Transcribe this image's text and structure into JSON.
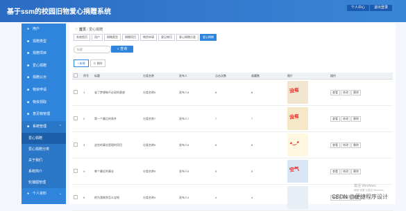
{
  "header": {
    "title": "基于ssm的校园旧物爱心捐赠系统",
    "buttons": [
      "个人中心",
      "退出登录"
    ]
  },
  "sidebar": {
    "items": [
      {
        "icon": "user-icon",
        "label": "用户"
      },
      {
        "icon": "grid-icon",
        "label": "捐赠类型"
      },
      {
        "icon": "grid-icon",
        "label": "捐赠项目"
      },
      {
        "icon": "grid-icon",
        "label": "爱心捐赠"
      },
      {
        "icon": "grid-icon",
        "label": "捐赠公示"
      },
      {
        "icon": "grid-icon",
        "label": "物资申请"
      },
      {
        "icon": "grid-icon",
        "label": "物资领取"
      },
      {
        "icon": "grid-icon",
        "label": "意见物管理"
      },
      {
        "icon": "grid-icon",
        "label": "系统管理"
      }
    ],
    "sub_items": [
      "爱心捐赠",
      "爱心捐赠分类",
      "关于我们",
      "系统简介",
      "轮播图管理"
    ],
    "last_item": {
      "icon": "person-icon",
      "label": "个人资料"
    }
  },
  "breadcrumb": {
    "home": "首页",
    "current": "爱心捐赠"
  },
  "tabs": [
    "系统首页",
    "用户",
    "捐赠类型",
    "捐赠项目",
    "物资申请",
    "意见物归",
    "意心捐赠分类",
    "爱心捐赠"
  ],
  "search": {
    "placeholder": "标题",
    "button_label": "查询"
  },
  "actions": {
    "add_label": "新增",
    "delete_label": "删除"
  },
  "table": {
    "headers": [
      "",
      "序号",
      "标题",
      "分类名称",
      "发布人",
      "点击次数",
      "收藏数",
      "图片",
      "操作"
    ],
    "rows": [
      {
        "index": "1",
        "title": "省了梦想每不必双的意惑",
        "category": "分类名称5",
        "publisher": "发布人8",
        "clicks": "8",
        "favorites": "8",
        "image_text": "没有",
        "image_bg": "#f3e6d0"
      },
      {
        "index": "2",
        "title": "第一个最后的条件",
        "category": "分类名称7",
        "publisher": "发布人7",
        "clicks": "7",
        "favorites": "7",
        "image_text": "没有",
        "image_bg": "#f5e8c8"
      },
      {
        "index": "3",
        "title": "这些的事实是理的项目",
        "category": "分类名称6",
        "publisher": "发布人6",
        "clicks": "6",
        "favorites": "6",
        "image_text": "◕‿◕",
        "image_bg": "#fff7e0"
      },
      {
        "index": "4",
        "title": "哪个最近的事业",
        "category": "分类名称5",
        "publisher": "发布人5",
        "clicks": "5",
        "favorites": "5",
        "image_text": "空气",
        "image_bg": "#d8e6f3"
      },
      {
        "index": "5",
        "title": "把为我做到怎么宝地",
        "category": "分类名称4",
        "publisher": "发布人4",
        "clicks": "4",
        "favorites": "4",
        "image_text": "",
        "image_bg": "#e8eef5"
      }
    ],
    "row_actions": [
      "查看",
      "修改",
      "删除"
    ]
  },
  "watermark": {
    "line1": "激活 Windows",
    "line2": "转到\"设置\"以激活 Windows。"
  },
  "csdn": "CSDN @便捷程序设计"
}
